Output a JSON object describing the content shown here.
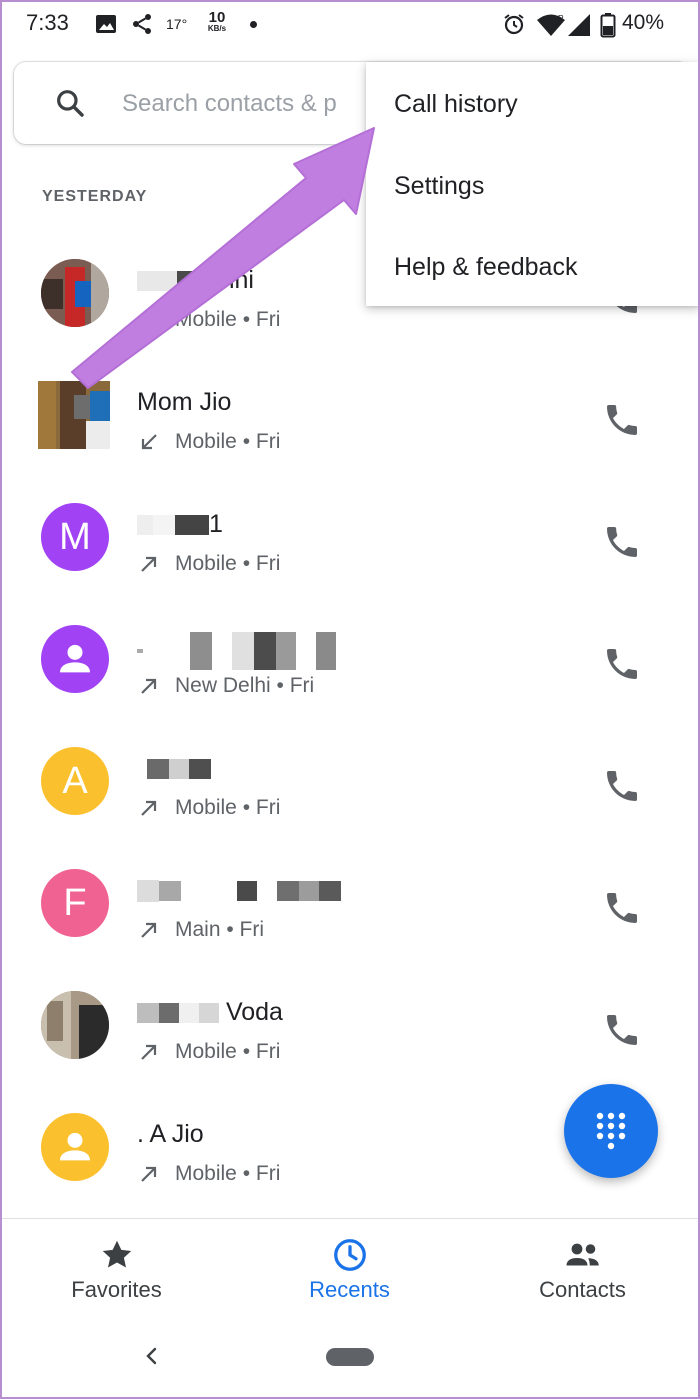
{
  "status_bar": {
    "time": "7:33",
    "temperature": "17°",
    "net_speed": "10",
    "net_unit": "KB/s",
    "battery": "40%"
  },
  "search": {
    "placeholder": "Search contacts & p"
  },
  "section": {
    "header": "YESTERDAY"
  },
  "menu": {
    "items": [
      {
        "label": "Call history"
      },
      {
        "label": "Settings"
      },
      {
        "label": "Help & feedback"
      }
    ]
  },
  "calls": [
    {
      "name": "Delhi",
      "detail": "Mobile • Fri",
      "direction": "none",
      "avatar": "photo"
    },
    {
      "name": "Mom Jio",
      "detail": "Mobile • Fri",
      "direction": "incoming",
      "avatar": "photo"
    },
    {
      "name": "1",
      "detail": "Mobile • Fri",
      "direction": "outgoing",
      "avatar": "M",
      "avatar_color": "#a142f4"
    },
    {
      "name": "",
      "detail": "New Delhi • Fri",
      "direction": "outgoing",
      "avatar": "person",
      "avatar_color": "#a142f4"
    },
    {
      "name": "",
      "detail": "Mobile • Fri",
      "direction": "outgoing",
      "avatar": "A",
      "avatar_color": "#fbc02d"
    },
    {
      "name": "",
      "detail": "Main • Fri",
      "direction": "outgoing",
      "avatar": "F",
      "avatar_color": "#f06292"
    },
    {
      "name": "Voda",
      "detail": "Mobile • Fri",
      "direction": "outgoing",
      "avatar": "photo"
    },
    {
      "name": ". A Jio",
      "detail": "Mobile • Fri",
      "direction": "outgoing",
      "avatar": "person",
      "avatar_color": "#fbc02d"
    }
  ],
  "bottom_nav": {
    "tabs": [
      {
        "label": "Favorites",
        "icon": "star-icon"
      },
      {
        "label": "Recents",
        "icon": "clock-icon",
        "active": true
      },
      {
        "label": "Contacts",
        "icon": "people-icon"
      }
    ]
  },
  "colors": {
    "accent": "#1a73e8",
    "arrow": "#c07fe0"
  }
}
